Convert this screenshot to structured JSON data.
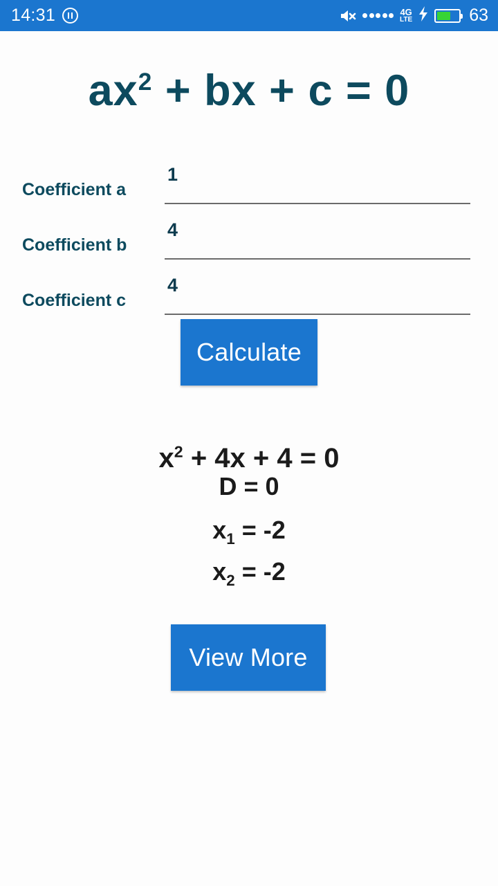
{
  "status_bar": {
    "time": "14:31",
    "dnd_icon": "do-not-disturb-icon",
    "mute_icon": "volume-mute-icon",
    "signal_dots": 5,
    "network_primary": "4G",
    "network_secondary": "LTE",
    "charging_icon": "charging-bolt-icon",
    "battery_percent": "63",
    "battery_fill_percent": 63,
    "background_color": "#1b76cf",
    "battery_color": "#37d435"
  },
  "app": {
    "title_prefix": "ax",
    "title_exponent": "2",
    "title_suffix": " + bx + c = 0",
    "title_color": "#0d4a5e",
    "accent_color": "#1b76cf"
  },
  "form": {
    "fields": [
      {
        "label": "Coefficient a",
        "value": "1",
        "placeholder": ""
      },
      {
        "label": "Coefficient b",
        "value": "4",
        "placeholder": ""
      },
      {
        "label": "Coefficient c",
        "value": "4",
        "placeholder": ""
      }
    ],
    "calculate_label": "Calculate"
  },
  "results": {
    "equation_base": "x",
    "equation_exponent": "2",
    "equation_rest": " + 4x + 4 = 0",
    "discriminant": "D = 0",
    "root1_var": "x",
    "root1_sub": "1",
    "root1_value": " = -2",
    "root2_var": "x",
    "root2_sub": "2",
    "root2_value": " = -2",
    "view_more_label": "View More"
  }
}
